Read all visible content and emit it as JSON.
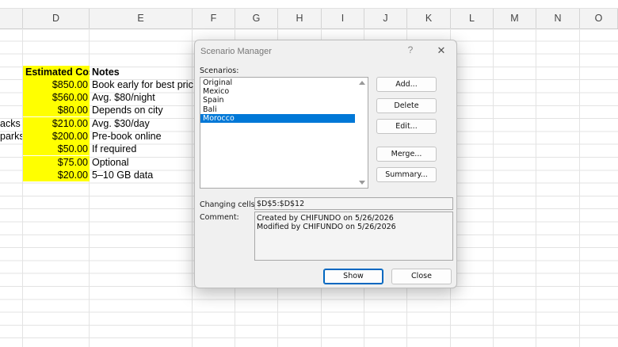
{
  "columns": [
    "D",
    "E",
    "F",
    "G",
    "H",
    "I",
    "J",
    "K",
    "L",
    "M",
    "N",
    "O"
  ],
  "cells": {
    "header_cost": "Estimated Cost",
    "header_notes": "Notes",
    "partial_c": [
      "acks",
      "parks"
    ],
    "costs": [
      "$850.00",
      "$560.00",
      "$80.00",
      "$210.00",
      "$200.00",
      "$50.00",
      "$75.00",
      "$20.00"
    ],
    "notes": [
      "Book early for best prices",
      "Avg. $80/night",
      "Depends on city",
      "Avg. $30/day",
      "Pre-book online",
      "If required",
      "Optional",
      "5–10 GB data"
    ]
  },
  "dialog": {
    "title": "Scenario Manager",
    "help": "?",
    "close": "✕",
    "scenarios_label": "Scenarios:",
    "scenarios": [
      "Original",
      "Mexico",
      "Spain",
      "Bali",
      "Morocco"
    ],
    "selected": "Morocco",
    "buttons": {
      "add": "Add...",
      "delete": "Delete",
      "edit": "Edit...",
      "merge": "Merge...",
      "summary": "Summary..."
    },
    "changing_cells_label": "Changing cells:",
    "changing_cells_value": "$D$5:$D$12",
    "comment_label": "Comment:",
    "comment_lines": [
      "Created by CHIFUNDO on 5/26/2026",
      "Modified by CHIFUNDO on 5/26/2026"
    ],
    "show": "Show",
    "close_button": "Close"
  },
  "colors": {
    "highlight": "#ffff00",
    "selection": "#0078d7"
  }
}
